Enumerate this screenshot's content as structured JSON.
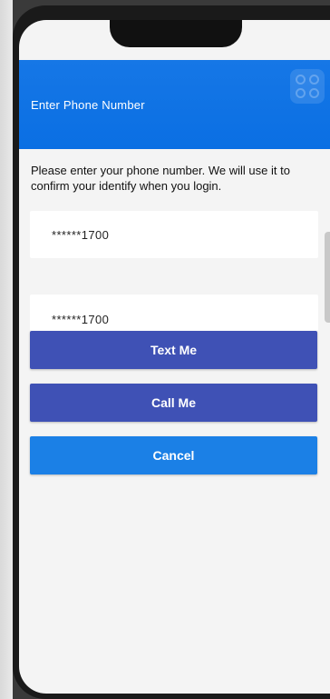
{
  "header": {
    "title": "Enter Phone Number",
    "logo_icon": "app-logo-icon"
  },
  "instructions": "Please enter your phone number. We will use it to confirm your identify when you login.",
  "phones": [
    {
      "masked_number": "******1700"
    },
    {
      "masked_number": "******1700"
    }
  ],
  "buttons": {
    "text_me": "Text Me",
    "call_me": "Call Me",
    "cancel": "Cancel"
  },
  "colors": {
    "header": "#0a6fe3",
    "primary_button": "#3f51b5",
    "cancel_button": "#1b80e6"
  }
}
